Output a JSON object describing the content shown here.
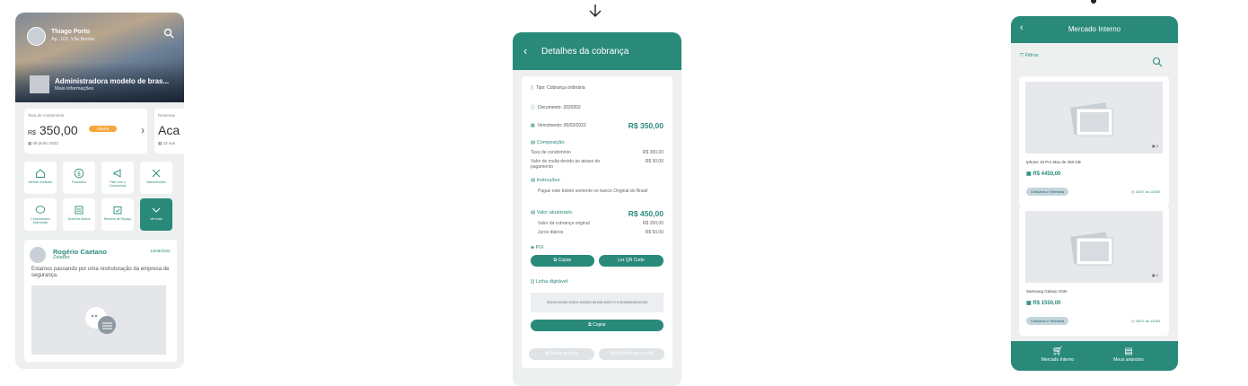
{
  "colors": {
    "accent": "#2a8a7a",
    "badge": "#f7a83b",
    "background": "#eef0f0"
  },
  "home": {
    "user_name": "Thiago Porto",
    "user_apartment": "Ap. 103, Vila Bonita",
    "admin_name": "Administradora modelo de bras...",
    "admin_more": "Mais informações",
    "fee_card": {
      "label": "Taxa de condomínio",
      "currency": "R$",
      "amount": "350,00",
      "status": "Aberta",
      "date": "08 junho 2022"
    },
    "reservations_card": {
      "label": "Reservas",
      "value": "Aca",
      "date": "23 mai"
    },
    "tiles": [
      {
        "label": "Minhas unidades",
        "icon": "house-icon"
      },
      {
        "label": "Financeiro",
        "icon": "dollar-icon"
      },
      {
        "label": "Fale com o Condomínio",
        "icon": "megaphone-icon"
      },
      {
        "label": "Manutenções",
        "icon": "tools-icon"
      },
      {
        "label": "Comunicados individuais",
        "icon": "chat-icon"
      },
      {
        "label": "Mural de Avisos",
        "icon": "board-icon"
      },
      {
        "label": "Reserva de Espaço",
        "icon": "calendar-icon"
      },
      {
        "label": "Ver mais",
        "icon": "chevron-down-icon"
      }
    ],
    "post": {
      "author": "Rogério Caetano",
      "role": "Zelador",
      "date": "12/08/2022",
      "text": "Estamos passando por uma restruturação da empresa de segurança."
    }
  },
  "billing": {
    "title": "Detalhes da cobrança",
    "type": "Tipo: Cobrança ordinária",
    "document": "Documento: 2020202",
    "due": "Vencimento: 06/02/2023",
    "due_amount": "R$ 350,00",
    "composition_title": "Composição:",
    "composition": [
      {
        "label": "Taxa de condomínio",
        "value": "R$ 300,00"
      },
      {
        "label": "Valor de multa devido ao atraso do pagamento",
        "value": "R$ 50,00"
      }
    ],
    "instructions_title": "Instruções:",
    "instructions": "Pague este boleto somente no banco Original do Brasil",
    "updated_title": "Valor atualizado:",
    "updated_amount": "R$ 450,00",
    "updated": [
      {
        "label": "Valor da cobrança original",
        "value": "R$ 350,00"
      },
      {
        "label": "Juros diários",
        "value": "R$ 50,00"
      }
    ],
    "pix_title": "PIX",
    "copy_label": "Copiar",
    "qr_label": "Ler QR Code",
    "line_title": "Linha digitável:",
    "line_code": "00190.00009 02874.902822 84408.453179 5 92400000010000",
    "copy2_label": "Copiar",
    "download_label": "Baixar arquivo",
    "email_label": "Receber por e-mail"
  },
  "market": {
    "title": "Mercado Interno",
    "filters_label": "Filtros",
    "products": [
      {
        "name": "Iphone 15 Pro Max de 256 GB",
        "price": "R$ 4450,00",
        "category": "Celulares e Telefonia",
        "time": "15/07 às 12h50",
        "photos": "4"
      },
      {
        "name": "Samsung Galaxy A03s",
        "price": "R$ 1550,00",
        "category": "Celulares e Telefonia",
        "time": "15/07 às 11h50",
        "photos": "4"
      }
    ],
    "tabs": [
      {
        "label": "Mercado Interno",
        "icon": "cart-icon"
      },
      {
        "label": "Meus anúncios",
        "icon": "list-icon"
      }
    ]
  }
}
